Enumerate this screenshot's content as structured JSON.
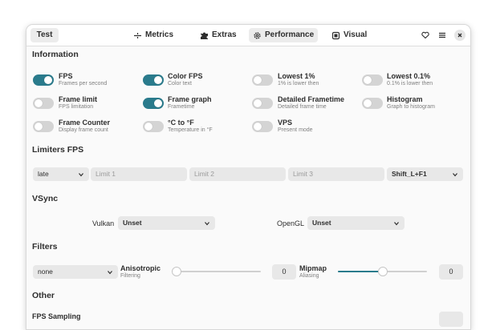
{
  "header": {
    "test_label": "Test",
    "tabs": [
      {
        "label": "Metrics",
        "icon": "metrics-icon",
        "active": false
      },
      {
        "label": "Extras",
        "icon": "puzzle-icon",
        "active": false
      },
      {
        "label": "Performance",
        "icon": "gear-icon",
        "active": true
      },
      {
        "label": "Visual",
        "icon": "palette-icon",
        "active": false
      }
    ],
    "icons": [
      "heart-icon",
      "menu-icon",
      "close-icon"
    ]
  },
  "information": {
    "title": "Information",
    "options": [
      {
        "title": "FPS",
        "subtitle": "Frames per second",
        "on": true
      },
      {
        "title": "Color FPS",
        "subtitle": "Color text",
        "on": true
      },
      {
        "title": "Lowest 1%",
        "subtitle": "1% is lower then",
        "on": false
      },
      {
        "title": "Lowest 0.1%",
        "subtitle": "0.1% is lower then",
        "on": false
      },
      {
        "title": "Frame limit",
        "subtitle": "FPS limitation",
        "on": false
      },
      {
        "title": "Frame graph",
        "subtitle": "Frametime",
        "on": true
      },
      {
        "title": "Detailed Frametime",
        "subtitle": "Detailed frame time",
        "on": false
      },
      {
        "title": "Histogram",
        "subtitle": "Graph to histogram",
        "on": false
      },
      {
        "title": "Frame Counter",
        "subtitle": "Display frame count",
        "on": false
      },
      {
        "title": "°C to °F",
        "subtitle": "Temperature in °F",
        "on": false
      },
      {
        "title": "VPS",
        "subtitle": "Present mode",
        "on": false
      }
    ]
  },
  "limiters": {
    "title": "Limiters FPS",
    "mode_value": "late",
    "limit1_placeholder": "Limit 1",
    "limit2_placeholder": "Limit 2",
    "limit3_placeholder": "Limit 3",
    "hotkey_value": "Shift_L+F1"
  },
  "vsync": {
    "title": "VSync",
    "vulkan_label": "Vulkan",
    "vulkan_value": "Unset",
    "opengl_label": "OpenGL",
    "opengl_value": "Unset"
  },
  "filters": {
    "title": "Filters",
    "filter_value": "none",
    "anisotropic_title": "Anisotropic",
    "anisotropic_subtitle": "Filtering",
    "anisotropic_level": 0.0,
    "anisotropic_value": "0",
    "mipmap_title": "Mipmap",
    "mipmap_subtitle": "Aliasing",
    "mipmap_level": 0.5,
    "mipmap_value": "0"
  },
  "other": {
    "title": "Other",
    "fps_sampling_label": "FPS Sampling"
  },
  "colors": {
    "accent": "#2a7b8c"
  }
}
